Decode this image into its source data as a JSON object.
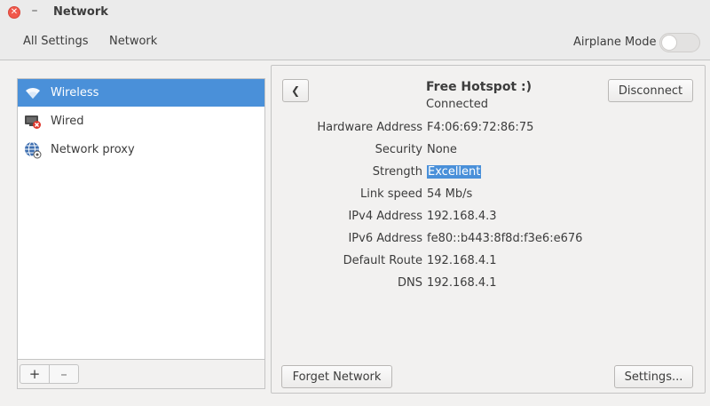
{
  "window": {
    "title": "Network",
    "close_glyph": "✕",
    "minimize_glyph": "–"
  },
  "header": {
    "all_settings": "All Settings",
    "section": "Network",
    "airplane_mode_label": "Airplane Mode",
    "airplane_mode_on": false
  },
  "sidebar": {
    "items": [
      {
        "label": "Wireless",
        "icon": "wifi-icon",
        "selected": true
      },
      {
        "label": "Wired",
        "icon": "wired-disconnected-icon",
        "selected": false
      },
      {
        "label": "Network proxy",
        "icon": "globe-icon",
        "selected": false
      }
    ],
    "add_label": "+",
    "remove_label": "–"
  },
  "detail": {
    "back_glyph": "❮",
    "network_name": "Free Hotspot :)",
    "status": "Connected",
    "disconnect_label": "Disconnect",
    "forget_label": "Forget Network",
    "settings_label": "Settings...",
    "rows": [
      {
        "label": "Hardware Address",
        "value": "F4:06:69:72:86:75"
      },
      {
        "label": "Security",
        "value": "None"
      },
      {
        "label": "Strength",
        "value": "Excellent"
      },
      {
        "label": "Link speed",
        "value": "54 Mb/s"
      },
      {
        "label": "IPv4 Address",
        "value": "192.168.4.3"
      },
      {
        "label": "IPv6 Address",
        "value": "fe80::b443:8f8d:f3e6:e676"
      },
      {
        "label": "Default Route",
        "value": "192.168.4.1"
      },
      {
        "label": "DNS",
        "value": "192.168.4.1"
      }
    ]
  },
  "colors": {
    "accent": "#4a90d9",
    "close": "#f1584b"
  }
}
